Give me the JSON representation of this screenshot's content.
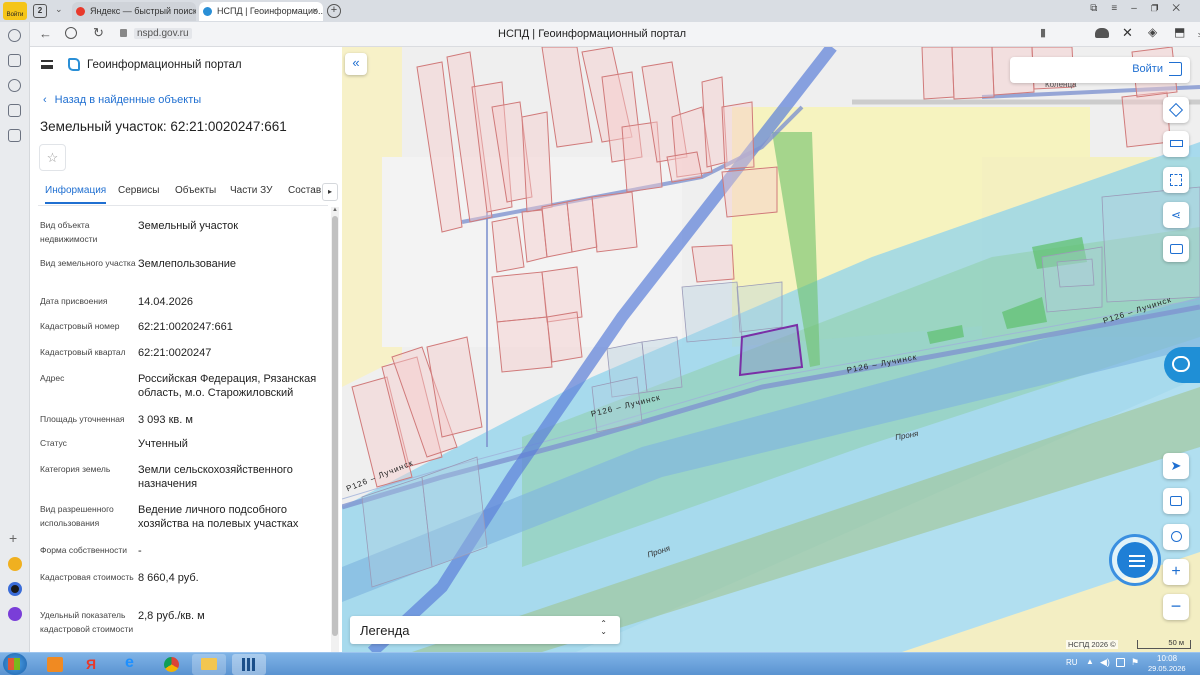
{
  "browser": {
    "login_badge": "Войти",
    "tab_count": "2",
    "tabs": [
      {
        "title": "Яндекс — быстрый поиск"
      },
      {
        "title": "НСПД | Геоинформацио..."
      }
    ],
    "url": "nspd.gov.ru",
    "page_title": "НСПД | Геоинформационный портал"
  },
  "portal": {
    "title": "Геоинформационный портал",
    "back_link": "Назад в найденные объекты",
    "object_title": "Земельный участок: 62:21:0020247:661",
    "tabs": [
      "Информация",
      "Сервисы",
      "Объекты",
      "Части ЗУ",
      "Состав"
    ],
    "fields": [
      {
        "label": "Вид объекта недвижимости",
        "value": "Земельный участок"
      },
      {
        "label": "Вид земельного участка",
        "value": "Землепользование"
      },
      {
        "label": "Дата присвоения",
        "value": "14.04.2026"
      },
      {
        "label": "Кадастровый номер",
        "value": "62:21:0020247:661"
      },
      {
        "label": "Кадастровый квартал",
        "value": "62:21:0020247"
      },
      {
        "label": "Адрес",
        "value": "Российская Федерация, Рязанская область, м.о. Старожиловский"
      },
      {
        "label": "Площадь уточненная",
        "value": "3 093 кв. м"
      },
      {
        "label": "Статус",
        "value": "Учтенный"
      },
      {
        "label": "Категория земель",
        "value": "Земли сельскохозяйственного назначения"
      },
      {
        "label": "Вид разрешенного использования",
        "value": "Ведение личного подсобного хозяйства на полевых участках"
      },
      {
        "label": "Форма собственности",
        "value": "-"
      },
      {
        "label": "Кадастровая стоимость",
        "value": "8 660,4 руб."
      },
      {
        "label": "Удельный показатель кадастровой стоимости",
        "value": "2,8 руб./кв. м"
      }
    ]
  },
  "map": {
    "login_label": "Войти",
    "legend_label": "Легенда",
    "road_labels": [
      "Р126 – Лучинск",
      "Р126 – Лучинск",
      "Р126 – Лучинск",
      "Р126 – Лучинск"
    ],
    "river_labels": [
      "Проня",
      "Проня"
    ],
    "street_label": "Коленца",
    "copyright": "НСПД 2026 ©",
    "scale": "50 м"
  },
  "taskbar": {
    "lang": "RU",
    "time": "10:08",
    "date": "29.05.2026"
  },
  "colors": {
    "accent": "#1f6fd1",
    "parcel_outline": "#d07a7a",
    "selected_parcel": "#7a2fa6",
    "water": "#7ec8e8",
    "road": "#5b7fd9"
  }
}
